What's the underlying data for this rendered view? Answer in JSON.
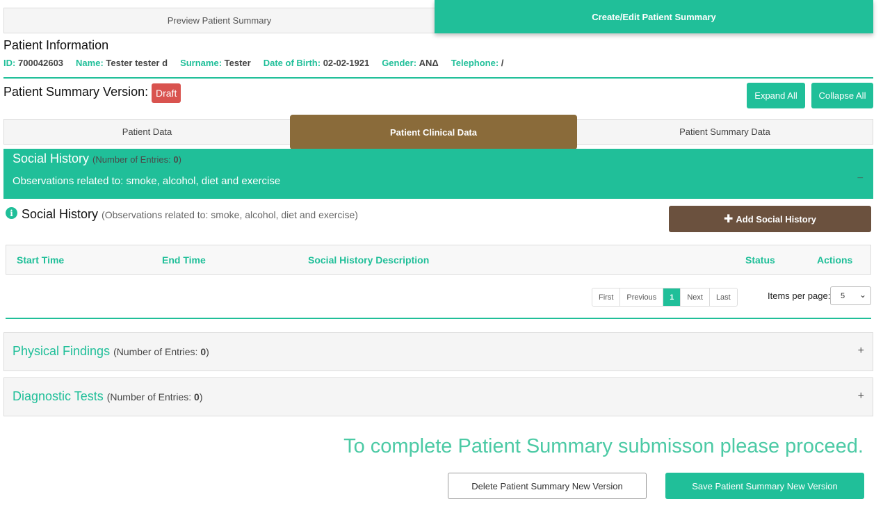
{
  "top_tabs": {
    "preview": "Preview Patient Summary",
    "create_edit": "Create/Edit Patient Summary"
  },
  "patient_info": {
    "title": "Patient Information",
    "id_label": "ID:",
    "id_value": "700042603",
    "name_label": "Name:",
    "name_value": "Tester tester d",
    "surname_label": "Surname:",
    "surname_value": "Tester",
    "dob_label": "Date of Birth:",
    "dob_value": "02-02-1921",
    "gender_label": "Gender:",
    "gender_value": "ΑΝΔ",
    "telephone_label": "Telephone:",
    "telephone_value": "/"
  },
  "version": {
    "title": "Patient Summary Version:",
    "badge": "Draft",
    "expand_all": "Expand All",
    "collapse_all": "Collapse All"
  },
  "sub_tabs": {
    "patient_data": "Patient Data",
    "clinical_data": "Patient Clinical Data",
    "summary_data": "Patient Summary Data"
  },
  "social_history": {
    "title": "Social History",
    "count_prefix": "(Number of Entries: ",
    "count": "0",
    "count_suffix": ")",
    "description": "Observations related to: smoke, alcohol, diet and exercise",
    "collapse_symbol": "−",
    "section_title": "Social History",
    "section_note": "(Observations related to: smoke, alcohol, diet and exercise)",
    "add_button": "Add Social History",
    "columns": [
      "Start Time",
      "End Time",
      "Social History Description",
      "Status",
      "Actions"
    ]
  },
  "pagination": {
    "first": "First",
    "previous": "Previous",
    "current": "1",
    "next": "Next",
    "last": "Last",
    "items_per_page_label": "Items per page:",
    "items_per_page_value": "5"
  },
  "physical_findings": {
    "title": "Physical Findings",
    "count_prefix": "(Number of Entries: ",
    "count": "0",
    "count_suffix": ")",
    "toggle": "+"
  },
  "diagnostic_tests": {
    "title": "Diagnostic Tests",
    "count_prefix": "(Number of Entries: ",
    "count": "0",
    "count_suffix": ")",
    "toggle": "+"
  },
  "footer": {
    "proceed_text": "To complete Patient Summary submisson please proceed.",
    "delete_button": "Delete Patient Summary New Version",
    "save_button": "Save Patient Summary New Version"
  },
  "colors": {
    "accent": "#20bf99",
    "brown_tab": "#8a6b3a",
    "brown_button": "#6b513e",
    "danger": "#d9534f"
  }
}
